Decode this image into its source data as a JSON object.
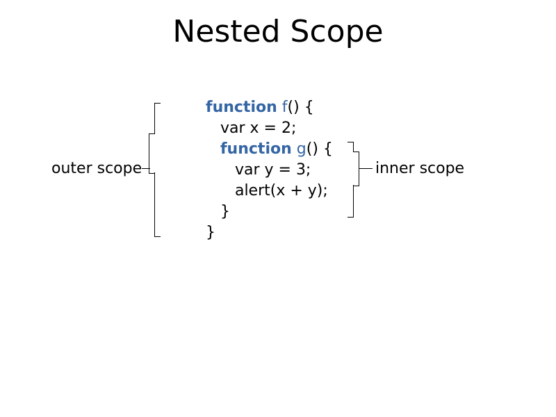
{
  "title": "Nested Scope",
  "labels": {
    "outer": "outer scope",
    "inner": "inner scope"
  },
  "code": {
    "kw_function1": "function",
    "fn_f": "f",
    "l1_rest": "() {",
    "l2": "   var x = 2;",
    "kw_function2": "function",
    "fn_g": "g",
    "l3_rest": "() {",
    "l4": "      var y = 3;",
    "l5": "      alert(x + y);",
    "l6": "   }",
    "l7": "}",
    "l3_indent": "   "
  }
}
